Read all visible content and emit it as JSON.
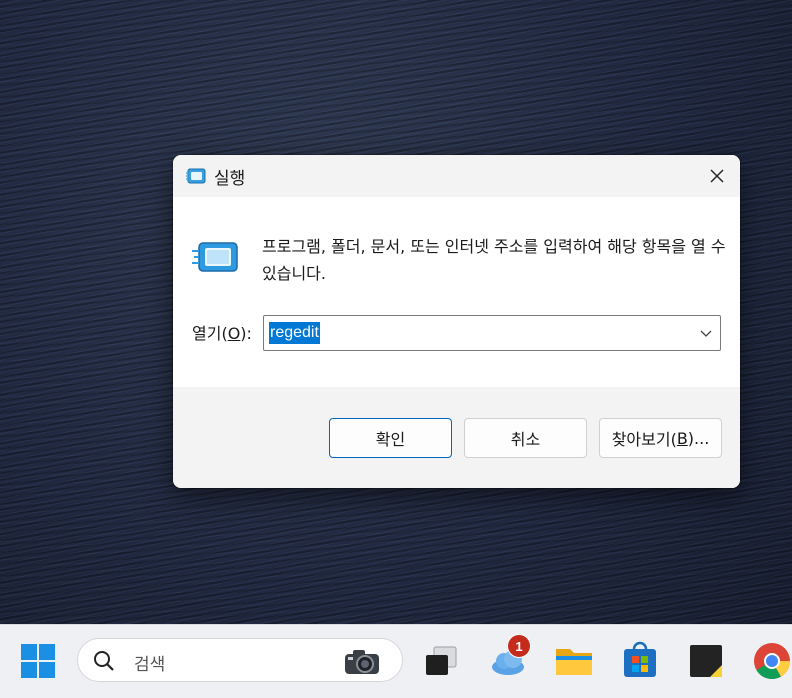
{
  "dialog": {
    "title": "실행",
    "description": "프로그램, 폴더, 문서, 또는 인터넷 주소를 입력하여 해당 항목을 열 수 있습니다.",
    "open_label_prefix": "열기(",
    "open_label_key": "O",
    "open_label_suffix": "):",
    "open_value": "regedit",
    "ok_label": "확인",
    "cancel_label": "취소",
    "browse_label_prefix": "찾아보기(",
    "browse_label_key": "B",
    "browse_label_suffix": ")..."
  },
  "taskbar": {
    "search_placeholder": "검색",
    "weather_badge": "1",
    "apps": [
      "start-icon",
      "task-view-icon",
      "weather-icon",
      "file-explorer-icon",
      "microsoft-store-icon",
      "sticky-notes-icon",
      "chrome-icon"
    ]
  },
  "colors": {
    "accent": "#0078d4",
    "badge": "#c42b1c"
  }
}
